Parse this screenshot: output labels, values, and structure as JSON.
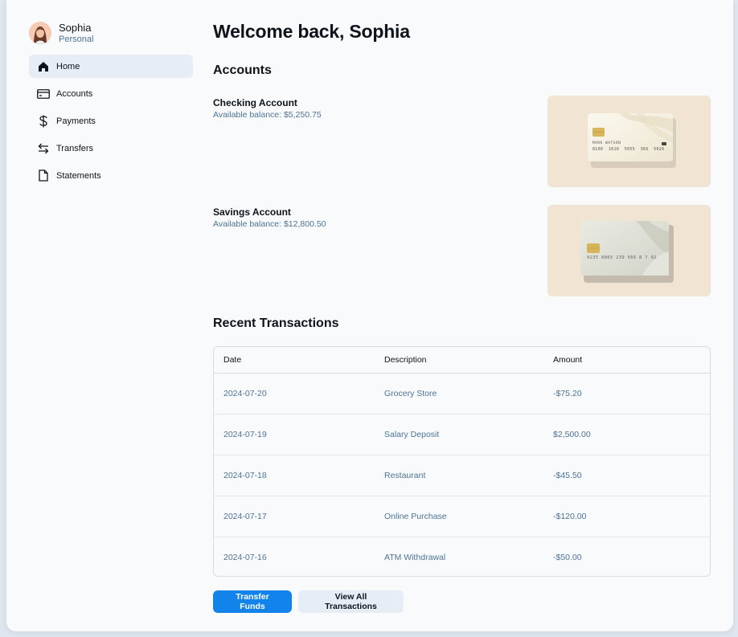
{
  "profile": {
    "name": "Sophia",
    "type": "Personal"
  },
  "sidebar": {
    "items": [
      {
        "label": "Home",
        "icon": "home-icon",
        "active": true
      },
      {
        "label": "Accounts",
        "icon": "credit-card-icon",
        "active": false
      },
      {
        "label": "Payments",
        "icon": "dollar-icon",
        "active": false
      },
      {
        "label": "Transfers",
        "icon": "arrows-left-right-icon",
        "active": false
      },
      {
        "label": "Statements",
        "icon": "file-icon",
        "active": false
      }
    ]
  },
  "main": {
    "title": "Welcome back, Sophia",
    "accounts_heading": "Accounts",
    "accounts": [
      {
        "name": "Checking Account",
        "balance": "Available balance: $5,250.75",
        "card_text": "MARK WATSON",
        "card_number": "8100  1610  5055  366  5026"
      },
      {
        "name": "Savings Account",
        "balance": "Available balance: $12,800.50",
        "card_number": "9235 8865 239 566 8 7 92"
      }
    ],
    "transactions_heading": "Recent Transactions",
    "table": {
      "headers": [
        "Date",
        "Description",
        "Amount"
      ],
      "rows": [
        [
          "2024-07-20",
          "Grocery Store",
          "-$75.20"
        ],
        [
          "2024-07-19",
          "Salary Deposit",
          "$2,500.00"
        ],
        [
          "2024-07-18",
          "Restaurant",
          "-$45.50"
        ],
        [
          "2024-07-17",
          "Online Purchase",
          "-$120.00"
        ],
        [
          "2024-07-16",
          "ATM Withdrawal",
          "-$50.00"
        ]
      ]
    },
    "buttons": {
      "transfer": "Transfer Funds",
      "view_all": "View All Transactions"
    }
  },
  "colors": {
    "accent": "#1383ec",
    "muted_text": "#4e7397",
    "active_bg": "#e7edf4",
    "card_bg": "#f1e4d2"
  }
}
